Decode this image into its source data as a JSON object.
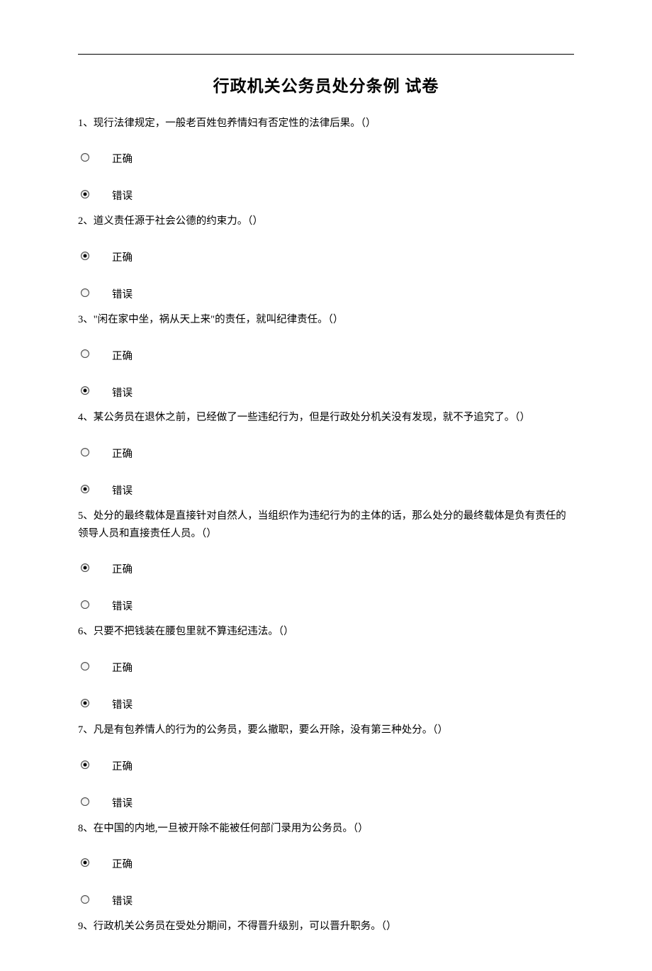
{
  "title": "行政机关公务员处分条例 试卷",
  "option_correct": "正确",
  "option_wrong": "错误",
  "questions": [
    {
      "num": "1、",
      "text": "现行法律规定，一般老百姓包养情妇有否定性的法律后果。（）",
      "selected": "b"
    },
    {
      "num": "2、",
      "text": "道义责任源于社会公德的约束力。（）",
      "selected": "a"
    },
    {
      "num": "3、",
      "text": "\"闲在家中坐，祸从天上来\"的责任，就叫纪律责任。（）",
      "selected": "b"
    },
    {
      "num": "4、",
      "text": "某公务员在退休之前，已经做了一些违纪行为，但是行政处分机关没有发现，就不予追究了。（）",
      "selected": "b"
    },
    {
      "num": "5、",
      "text": "处分的最终载体是直接针对自然人，当组织作为违纪行为的主体的话，那么处分的最终载体是负有责任的领导人员和直接责任人员。（）",
      "selected": "a"
    },
    {
      "num": "6、",
      "text": "只要不把钱装在腰包里就不算违纪违法。（）",
      "selected": "b"
    },
    {
      "num": "7、",
      "text": "凡是有包养情人的行为的公务员，要么撤职，要么开除，没有第三种处分。（）",
      "selected": "a"
    },
    {
      "num": "8、",
      "text": "在中国的内地,一旦被开除不能被任何部门录用为公务员。（）",
      "selected": "a"
    },
    {
      "num": "9、",
      "text": "行政机关公务员在受处分期间，不得晋升级别，可以晋升职务。（）",
      "selected": null
    }
  ]
}
